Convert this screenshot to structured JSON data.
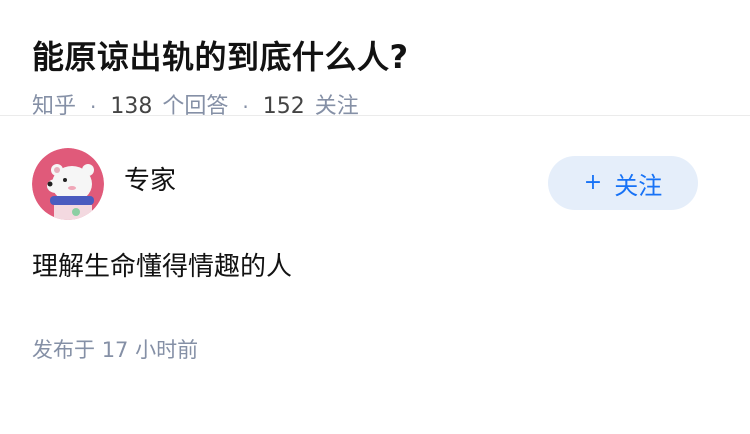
{
  "question": {
    "title": "能原谅出轨的到底什么人?",
    "source": "知乎",
    "answers_count": "138",
    "answers_label": "个回答",
    "follows_count": "152",
    "follows_label": "关注",
    "separator": "·"
  },
  "answer": {
    "author_name": "专家",
    "follow_label": "关注",
    "follow_plus": "+",
    "bio": "理解生命懂得情趣的人",
    "published_label": "发布于",
    "published_time": "17 小时前"
  },
  "colors": {
    "title": "#121212",
    "meta": "#8590a6",
    "follow_bg": "#e5eefa",
    "follow_text": "#1772f6",
    "avatar_bg": "#e05a7a"
  },
  "icons": {
    "avatar": "bear-avatar-icon"
  }
}
